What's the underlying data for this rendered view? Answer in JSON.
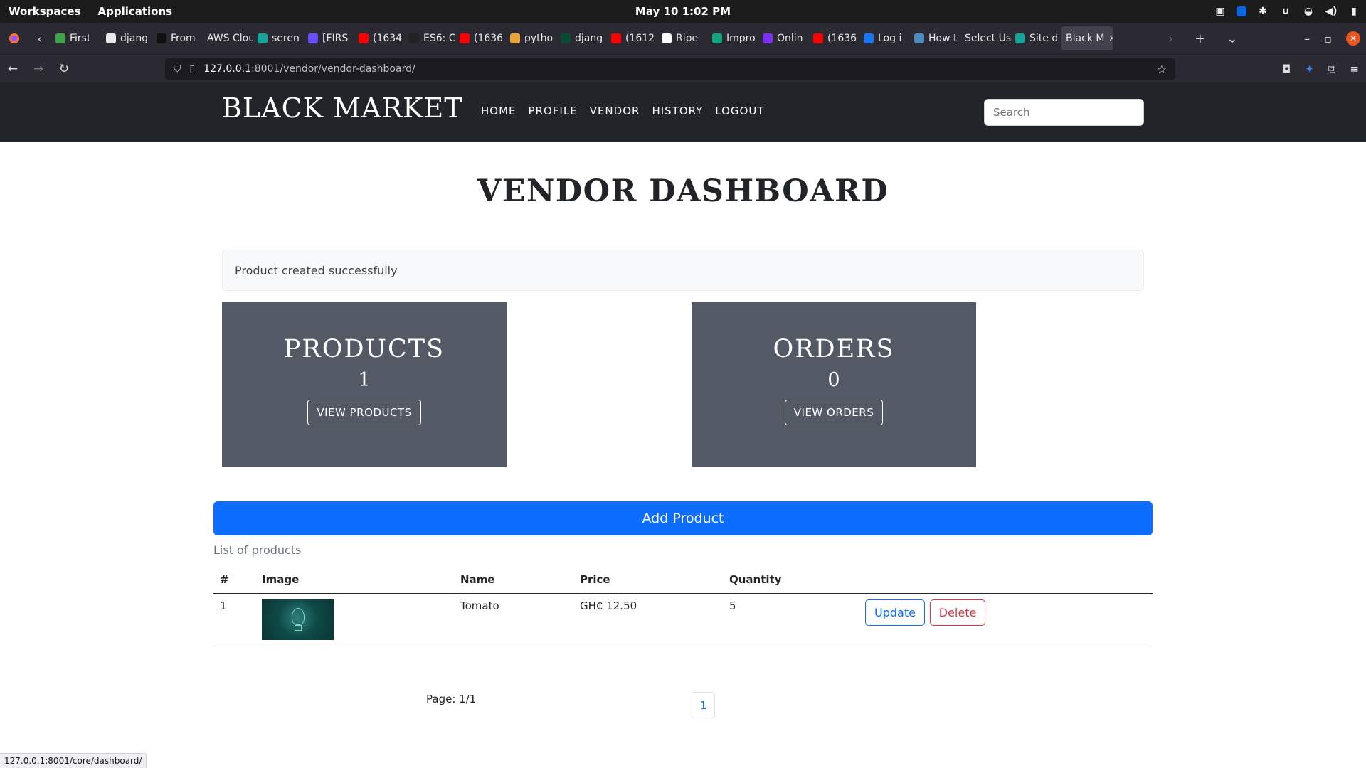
{
  "os": {
    "workspaces": "Workspaces",
    "applications": "Applications",
    "clock": "May 10  1:02 PM"
  },
  "browser": {
    "tabs": [
      {
        "label": "First",
        "color": "#3ea34a"
      },
      {
        "label": "djang",
        "color": "#e8e8e8"
      },
      {
        "label": "From",
        "color": "#111111"
      },
      {
        "label": "AWS Clou",
        "color": ""
      },
      {
        "label": "seren",
        "color": "#16a39a"
      },
      {
        "label": "[FIRS",
        "color": "#6b4cff"
      },
      {
        "label": "(1634",
        "color": "#ff0000"
      },
      {
        "label": "ES6: C",
        "color": "#222222"
      },
      {
        "label": "(1636",
        "color": "#ff0000"
      },
      {
        "label": "pytho",
        "color": "#e8a33b"
      },
      {
        "label": "djang",
        "color": "#0c4b33"
      },
      {
        "label": "(1612",
        "color": "#ff0000"
      },
      {
        "label": "Ripe",
        "color": "#ffffff"
      },
      {
        "label": "Impro",
        "color": "#10a37f"
      },
      {
        "label": "Onlin",
        "color": "#7b2ff7"
      },
      {
        "label": "(1636",
        "color": "#ff0000"
      },
      {
        "label": "Log i",
        "color": "#1877f2"
      },
      {
        "label": "How t",
        "color": "#4b8bbe"
      },
      {
        "label": "Select Us",
        "color": ""
      },
      {
        "label": "Site d",
        "color": "#16a39a"
      },
      {
        "label": "Black M",
        "color": ""
      }
    ],
    "url_host": "127.0.0.1",
    "url_rest": ":8001/vendor/vendor-dashboard/",
    "status_url": "127.0.0.1:8001/core/dashboard/"
  },
  "site": {
    "brand": "BLACK MARKET",
    "nav": [
      "HOME",
      "PROFILE",
      "VENDOR",
      "HISTORY",
      "LOGOUT"
    ],
    "search_placeholder": "Search"
  },
  "dashboard": {
    "title": "VENDOR DASHBOARD",
    "alert": "Product created successfully",
    "products": {
      "title": "PRODUCTS",
      "count": "1",
      "button": "VIEW PRODUCTS"
    },
    "orders": {
      "title": "ORDERS",
      "count": "0",
      "button": "VIEW ORDERS"
    },
    "add_button": "Add Product",
    "list_caption": "List of products",
    "table": {
      "headers": [
        "#",
        "Image",
        "Name",
        "Price",
        "Quantity"
      ],
      "rows": [
        {
          "num": "1",
          "name": "Tomato",
          "price": "GH₵ 12.50",
          "quantity": "5",
          "update": "Update",
          "delete": "Delete"
        }
      ]
    },
    "page_info": "Page: 1/1",
    "current_page": "1"
  }
}
